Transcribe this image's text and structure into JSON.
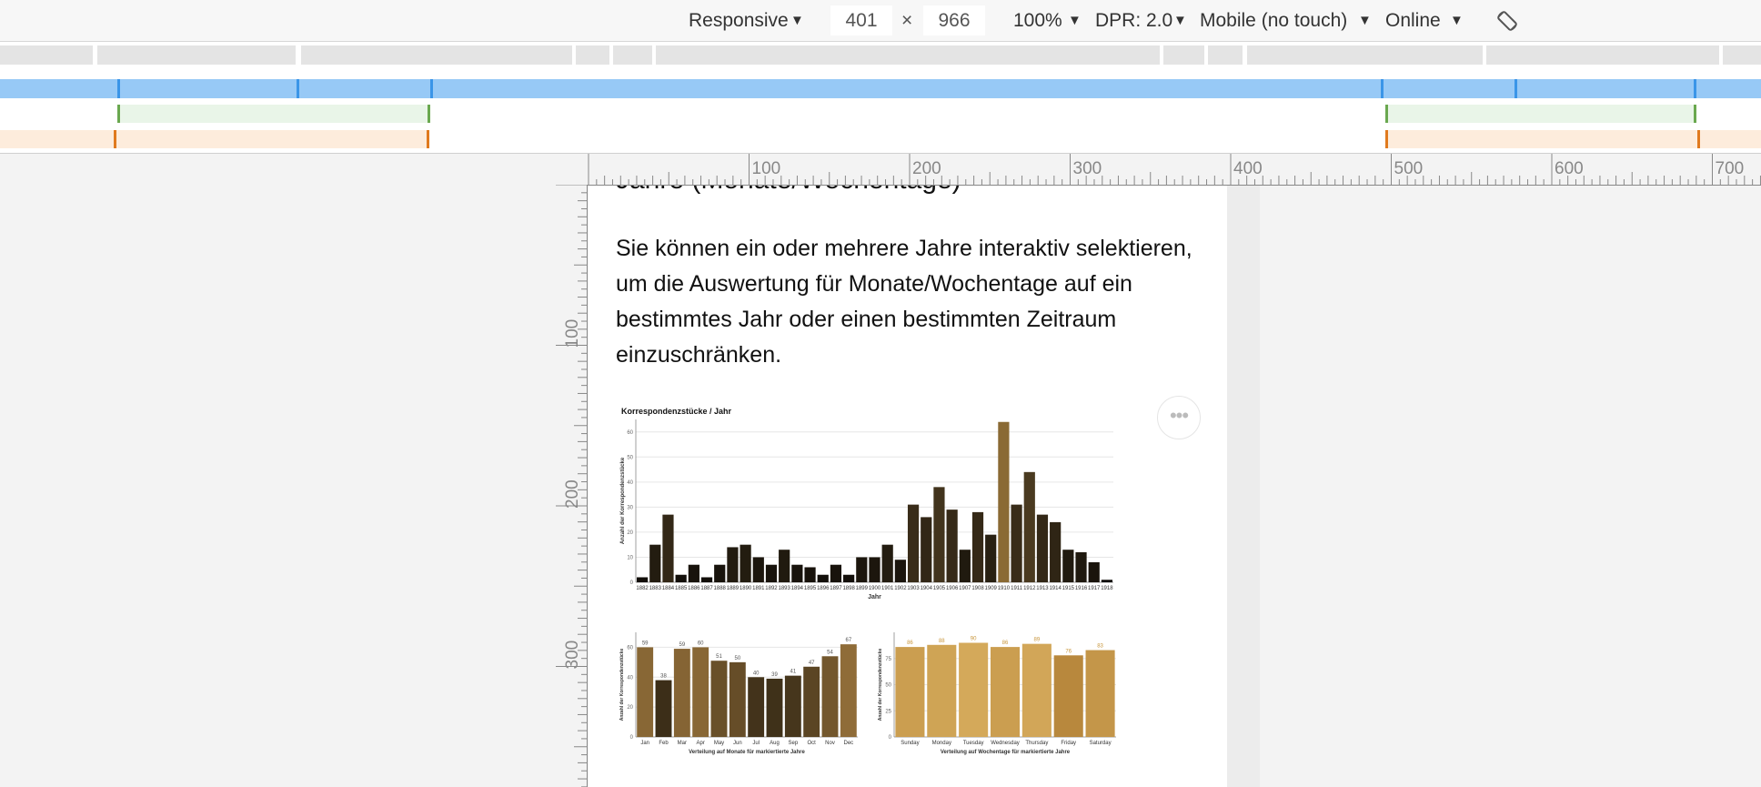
{
  "toolbar": {
    "device": "Responsive",
    "width": "401",
    "separator": "×",
    "height": "966",
    "zoom": "100%",
    "dpr": "DPR: 2.0",
    "touch": "Mobile (no touch)",
    "network": "Online",
    "caret": "▼",
    "rotate_icon": "rotate-icon"
  },
  "rulers": {
    "top_labels": [
      "100",
      "200",
      "300",
      "400",
      "500",
      "600",
      "700"
    ],
    "left_labels": [
      "100",
      "200",
      "300"
    ]
  },
  "page": {
    "heading": "Jahre (Monate/Wochentage)",
    "intro": "Sie können ein oder mehrere Jahre interaktiv selektieren, um die Auswertung für Monate/Wochentage auf ein bestimmtes Jahr oder einen bestimmten Zeitraum einzuschränken.",
    "more_button": "•••"
  },
  "colors": {
    "media_blue": "#97c9f6",
    "media_blue_tick": "#3a95e8",
    "media_green": "#e9f5e8",
    "media_green_tick": "#6aa84f",
    "media_orange": "#fdecdc",
    "media_orange_tick": "#e07a1e",
    "bar_dark": "#221b0d",
    "bar_highlight": "#8a6a34"
  },
  "chart_data": [
    {
      "type": "bar",
      "title": "Korrespondenzstücke / Jahr",
      "xlabel": "Jahr",
      "ylabel": "Anzahl der Korrespondenzstücke",
      "ylim": [
        0,
        65
      ],
      "yticks": [
        "0",
        "10",
        "20",
        "30",
        "40",
        "50",
        "60"
      ],
      "categories": [
        "1882",
        "1883",
        "1884",
        "1885",
        "1886",
        "1887",
        "1888",
        "1889",
        "1890",
        "1891",
        "1892",
        "1893",
        "1894",
        "1895",
        "1896",
        "1897",
        "1898",
        "1899",
        "1900",
        "1901",
        "1902",
        "1903",
        "1904",
        "1905",
        "1906",
        "1907",
        "1908",
        "1909",
        "1910",
        "1911",
        "1912",
        "1913",
        "1914",
        "1915",
        "1916",
        "1917",
        "1918"
      ],
      "values": [
        2,
        15,
        27,
        3,
        7,
        2,
        7,
        14,
        15,
        10,
        7,
        13,
        7,
        6,
        3,
        7,
        3,
        10,
        10,
        15,
        9,
        31,
        26,
        38,
        29,
        13,
        28,
        19,
        64,
        31,
        44,
        27,
        24,
        13,
        12,
        8,
        1
      ],
      "highlight": "1910"
    },
    {
      "type": "bar",
      "xlabel": "Verteilung auf Monate für markiertierte Jahre",
      "ylabel": "Anzahl der Korrespondenzstücke",
      "ylim": [
        0,
        70
      ],
      "yticks": [
        "0",
        "20",
        "40",
        "60"
      ],
      "categories": [
        "Jan",
        "Feb",
        "Mar",
        "Apr",
        "May",
        "Jun",
        "Jul",
        "Aug",
        "Sep",
        "Oct",
        "Nov",
        "Dec"
      ],
      "values": [
        60,
        38,
        59,
        60,
        51,
        50,
        40,
        39,
        41,
        47,
        54,
        62
      ],
      "labels": [
        "59",
        "38",
        "59",
        "60",
        "51",
        "50",
        "40",
        "39",
        "41",
        "47",
        "54",
        "67"
      ]
    },
    {
      "type": "bar",
      "xlabel": "Verteilung auf Wochentage für markiertierte Jahre",
      "ylabel": "Anzahl der Korrespondenzstücke",
      "ylim": [
        0,
        100
      ],
      "yticks": [
        "0",
        "25",
        "50",
        "75"
      ],
      "categories": [
        "Sunday",
        "Monday",
        "Tuesday",
        "Wednesday",
        "Thursday",
        "Friday",
        "Saturday"
      ],
      "values": [
        86,
        88,
        90,
        86,
        89,
        78,
        83
      ],
      "labels": [
        "86",
        "88",
        "90",
        "86",
        "89",
        "76",
        "83"
      ]
    }
  ]
}
